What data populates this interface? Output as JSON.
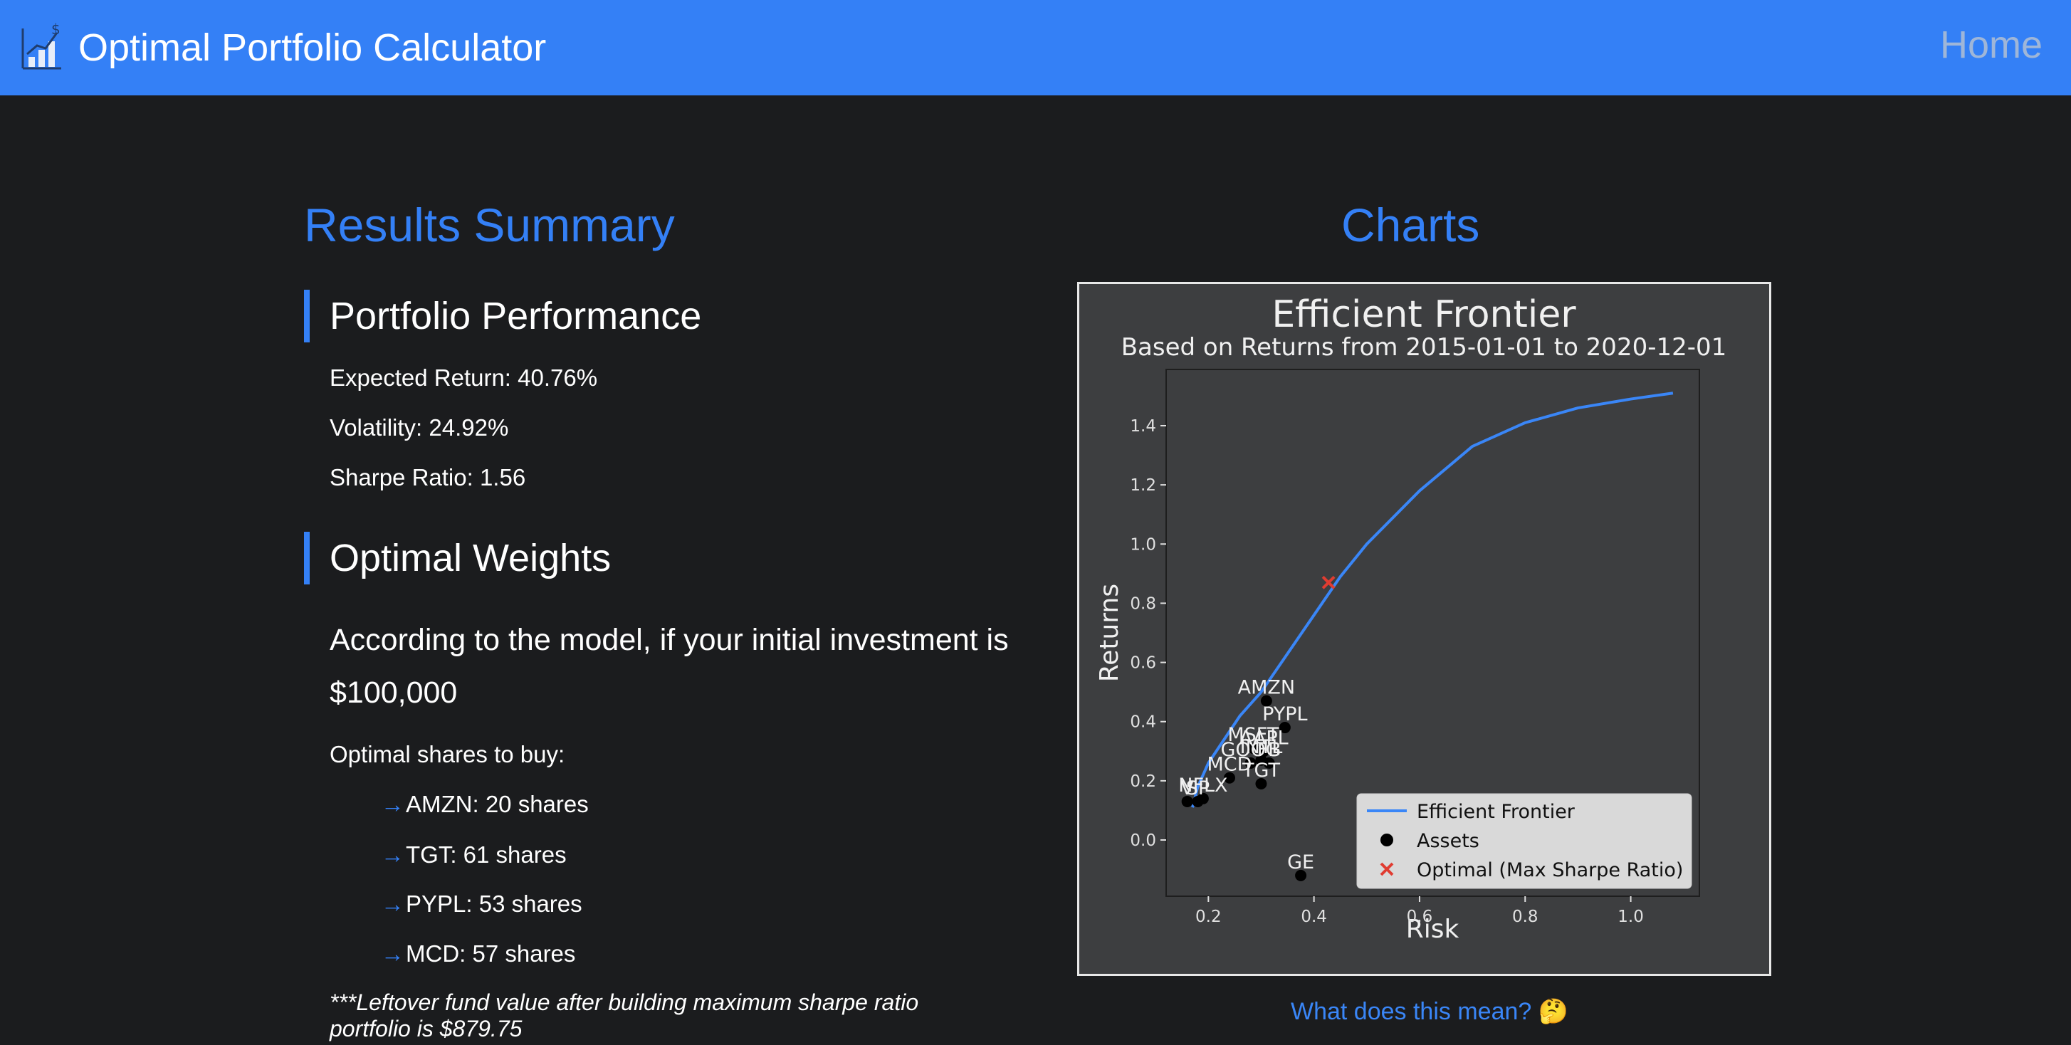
{
  "nav": {
    "title": "Optimal Portfolio Calculator",
    "home": "Home",
    "logo_icon": "chart-dollar-icon"
  },
  "summary": {
    "heading": "Results Summary",
    "performance": {
      "heading": "Portfolio Performance",
      "expected_return": "Expected Return: 40.76%",
      "volatility": "Volatility: 24.92%",
      "sharpe": "Sharpe Ratio: 1.56"
    },
    "weights": {
      "heading": "Optimal Weights",
      "intro": "According to the model, if your initial investment is $100,000",
      "shares_label": "Optimal shares to buy:",
      "shares": [
        {
          "arrow": "→",
          "text": "AMZN: 20 shares"
        },
        {
          "arrow": "→",
          "text": "TGT: 61 shares"
        },
        {
          "arrow": "→",
          "text": "PYPL: 53 shares"
        },
        {
          "arrow": "→",
          "text": "MCD: 57 shares"
        }
      ],
      "leftover": "***Leftover fund value after building maximum sharpe ratio portfolio is $879.75"
    }
  },
  "charts": {
    "heading": "Charts",
    "more_link": "What does this mean? 🤔"
  },
  "chart_data": {
    "type": "scatter",
    "title": "Efficient Frontier",
    "subtitle": "Based on Returns from 2015-01-01 to 2020-12-01",
    "xlabel": "Risk",
    "ylabel": "Returns",
    "xlim": [
      0.12,
      1.13
    ],
    "ylim": [
      -0.19,
      1.59
    ],
    "xticks": [
      0.2,
      0.4,
      0.6,
      0.8,
      1.0
    ],
    "yticks": [
      0.0,
      0.2,
      0.4,
      0.6,
      0.8,
      1.0,
      1.2,
      1.4
    ],
    "grid": false,
    "legend_position": "lower-right",
    "colors": {
      "frontier": "#3a86f7",
      "asset": "#000000",
      "optimal": "#e03c31",
      "plot_bg": "#3d3e40",
      "label": "#f0f0f0"
    },
    "series": [
      {
        "name": "Efficient Frontier",
        "type": "line",
        "points": [
          [
            0.17,
            0.11
          ],
          [
            0.18,
            0.18
          ],
          [
            0.2,
            0.26
          ],
          [
            0.23,
            0.34
          ],
          [
            0.26,
            0.42
          ],
          [
            0.3,
            0.5
          ],
          [
            0.35,
            0.63
          ],
          [
            0.4,
            0.76
          ],
          [
            0.45,
            0.89
          ],
          [
            0.5,
            1.0
          ],
          [
            0.6,
            1.18
          ],
          [
            0.7,
            1.33
          ],
          [
            0.8,
            1.41
          ],
          [
            0.9,
            1.46
          ],
          [
            1.0,
            1.49
          ],
          [
            1.08,
            1.51
          ]
        ]
      },
      {
        "name": "Assets",
        "type": "scatter",
        "points": [
          {
            "label": "AMZN",
            "x": 0.31,
            "y": 0.47
          },
          {
            "label": "PYPL",
            "x": 0.345,
            "y": 0.38
          },
          {
            "label": "MSFT",
            "x": 0.285,
            "y": 0.31
          },
          {
            "label": "AAPL",
            "x": 0.305,
            "y": 0.3
          },
          {
            "label": "INTL",
            "x": 0.3,
            "y": 0.27
          },
          {
            "label": "FB",
            "x": 0.315,
            "y": 0.26
          },
          {
            "label": "GOOG",
            "x": 0.28,
            "y": 0.26
          },
          {
            "label": "MCD",
            "x": 0.24,
            "y": 0.21
          },
          {
            "label": "TGT",
            "x": 0.3,
            "y": 0.19
          },
          {
            "label": "V",
            "x": 0.16,
            "y": 0.13
          },
          {
            "label": "SP",
            "x": 0.18,
            "y": 0.13
          },
          {
            "label": "NFLX",
            "x": 0.19,
            "y": 0.14
          },
          {
            "label": "GE",
            "x": 0.375,
            "y": -0.12
          }
        ]
      },
      {
        "name": "Optimal (Max Sharpe Ratio)",
        "type": "marker",
        "points": [
          {
            "x": 0.4276,
            "y": 0.87
          }
        ]
      }
    ]
  }
}
